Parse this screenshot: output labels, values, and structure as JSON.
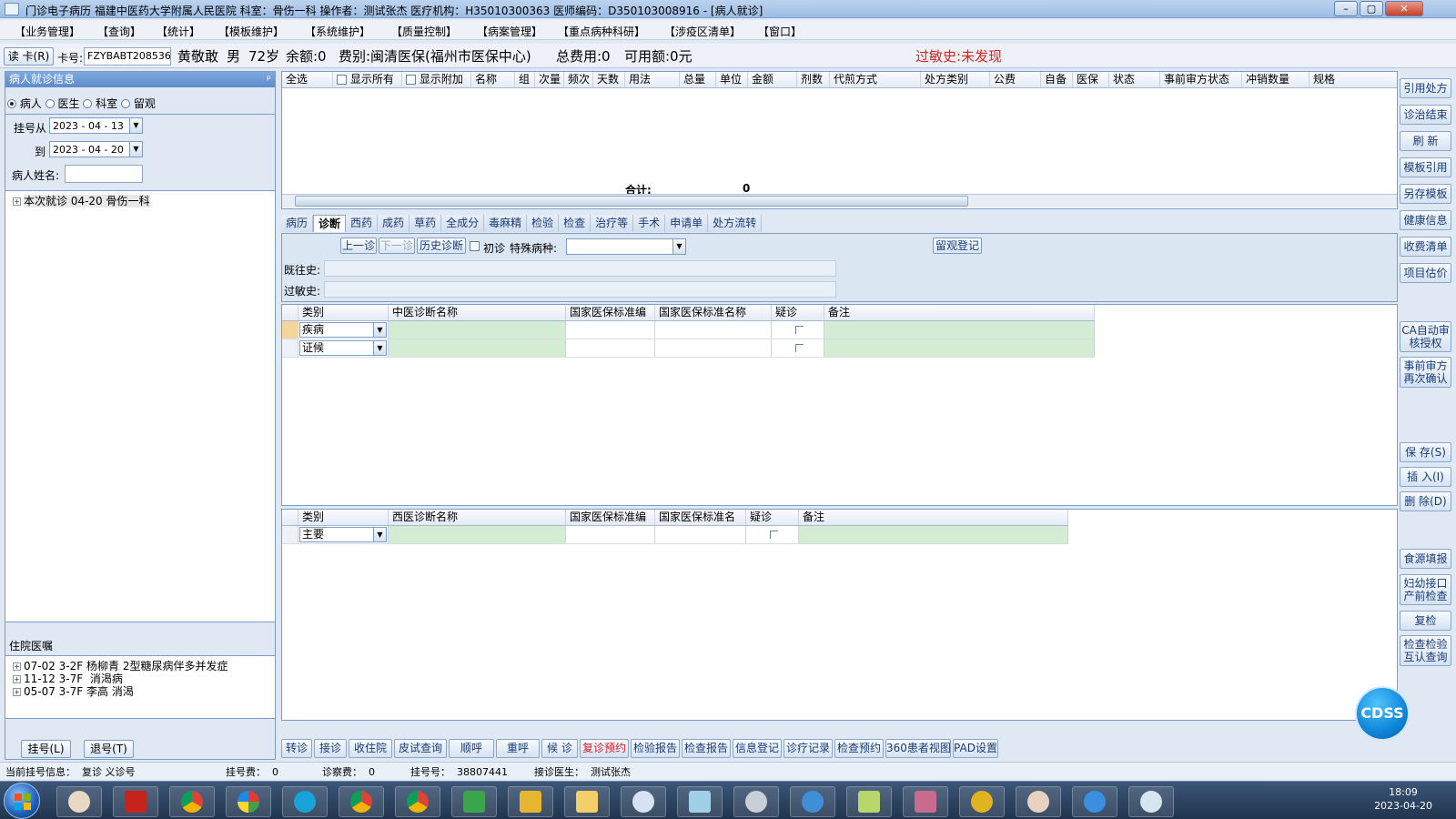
{
  "titlebar": {
    "title": "门诊电子病历  福建中医药大学附属人民医院  科室：骨伤一科  操作者：测试张杰  医疗机构：H35010300363  医师编码：D350103008916 - [病人就诊]",
    "min": "–",
    "max": "▢",
    "close": "✕"
  },
  "menu": [
    "【业务管理】",
    "【查询】",
    "【统计】",
    "【模板维护】",
    "【系统维护】",
    "【质量控制】",
    "【病案管理】",
    "【重点病种科研】",
    "【涉疫区清单】",
    "【窗口】"
  ],
  "patient": {
    "read_card": "读 卡(R)",
    "card_label": "卡号:",
    "card_no": "FZYBABT208536",
    "name": "黄敬敢",
    "sex": "男",
    "age": "72岁",
    "balance": "余额:0",
    "fee_type": "费别:闽清医保(福州市医保中心)",
    "total": "总费用:0",
    "available": "可用额:0元",
    "allergy": "过敏史:未发现"
  },
  "left": {
    "header": "病人就诊信息",
    "pin": "ᵖ",
    "radios": [
      {
        "label": "病人",
        "checked": true
      },
      {
        "label": "医生",
        "checked": false
      },
      {
        "label": "科室",
        "checked": false
      },
      {
        "label": "留观",
        "checked": false
      }
    ],
    "reg_from_label": "挂号从",
    "reg_from": "2023 - 04 - 13",
    "reg_to_label": "到",
    "reg_to": "2023 - 04 - 20",
    "name_label": "病人姓名:",
    "tree_item": "本次就诊 04-20 骨伤一科",
    "inpatient_header": "住院医嘱",
    "inpatient": [
      "07-02 3-2F 杨柳青 2型糖尿病伴多并发症",
      "11-12 3-7F  消渴病",
      "05-07 3-7F 李高 消渴"
    ],
    "register_btn": "挂号(L)",
    "unregister_btn": "退号(T)"
  },
  "rx_table": {
    "select_all": "全选",
    "show_all": "显示所有",
    "show_extra": "显示附加",
    "columns": [
      "名称",
      "组",
      "次量",
      "频次",
      "天数",
      "用法",
      "总量",
      "单位",
      "金额",
      "剂数",
      "代煎方式",
      "处方类别",
      "公费",
      "自备",
      "医保",
      "状态",
      "事前审方状态",
      "冲销数量",
      "规格"
    ],
    "total_label": "合计:",
    "total_value": "0"
  },
  "tabs": [
    "病历",
    "诊断",
    "西药",
    "成药",
    "草药",
    "全成分",
    "毒麻精",
    "检验",
    "检查",
    "治疗等",
    "手术",
    "申请单",
    "处方流转"
  ],
  "active_tab": "诊断",
  "diag": {
    "prev": "上一诊",
    "next": "下一诊",
    "history": "历史诊断",
    "first_visit": "初诊",
    "special_label": "特殊病种:",
    "observe_btn": "留观登记",
    "past_label": "既往史:",
    "allergy_label": "过敏史:"
  },
  "tcm_grid": {
    "columns": [
      "类别",
      "中医诊断名称",
      "国家医保标准编",
      "国家医保标准名称",
      "疑诊",
      "备注"
    ],
    "rows": [
      {
        "type": "疾病"
      },
      {
        "type": "证候"
      }
    ]
  },
  "wm_grid": {
    "columns": [
      "类别",
      "西医诊断名称",
      "国家医保标准编",
      "国家医保标准名",
      "疑诊",
      "备注"
    ],
    "rows": [
      {
        "type": "主要"
      }
    ]
  },
  "right_buttons": [
    "引用处方",
    "诊治结束",
    "刷 新",
    "模板引用",
    "另存模板",
    "健康信息",
    "收费清单",
    "项目估价"
  ],
  "right_ca": "CA自动审核授权",
  "right_pre": "事前审方再次确认",
  "right_save": [
    "保 存(S)",
    "插 入(I)",
    "删 除(D)"
  ],
  "right_bottom": [
    "食源填报",
    "妇幼接口产前检查",
    "复检",
    "检查检验互认查询"
  ],
  "bottom_buttons": [
    "转诊",
    "接诊",
    "收住院",
    "皮试查询",
    "顺呼",
    "重呼",
    "候 诊",
    "复诊预约",
    "检验报告",
    "检查报告",
    "信息登记",
    "诊疗记录",
    "检查预约",
    "360患者视图",
    "PAD设置"
  ],
  "status": {
    "current": "当前挂号信息：  复诊 义诊号",
    "reg_fee": "挂号费：  0",
    "diag_fee": "诊察费：  0",
    "reg_no": "挂号号：  38807441",
    "doctor": "接诊医生：  测试张杰"
  },
  "cdss": "CDSS",
  "clock": {
    "time": "18:09",
    "date": "2023-04-20"
  },
  "taskbar_icons": [
    "doctor-app",
    "pdf-reader",
    "chrome",
    "photos",
    "sogou",
    "chrome",
    "chrome",
    "spreadsheet",
    "sql-tool",
    "folder",
    "sql-query",
    "notes",
    "compass",
    "browser",
    "notepad",
    "database",
    "ultraedit",
    "medical-app",
    "ie",
    "medical-app-2"
  ],
  "colors": {
    "accent": "#5d8ccd",
    "allergy": "#e0201c",
    "reserve": "#d8202a",
    "green_cell": "#d5ecd4"
  }
}
